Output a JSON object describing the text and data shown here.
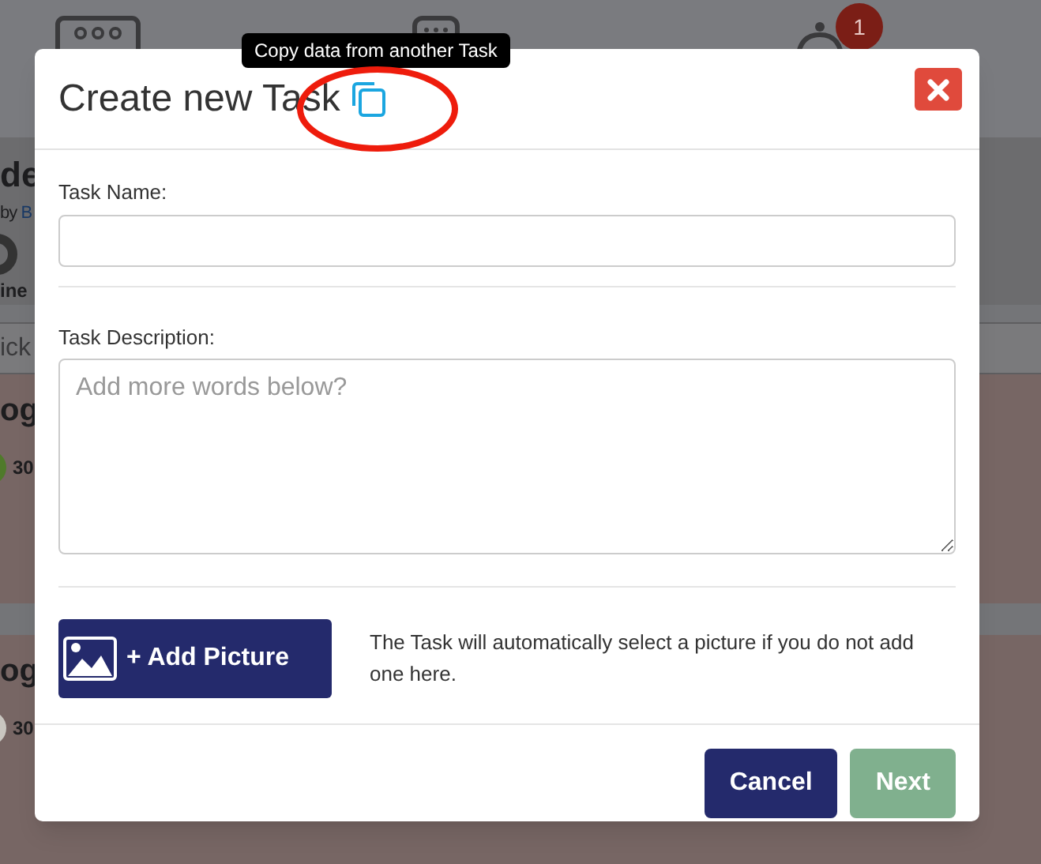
{
  "background": {
    "notification_badge": "1",
    "page_title": "de",
    "byline": {
      "prefix": "by",
      "author": "B"
    },
    "stat_label": "ine",
    "search_placeholder": "ick",
    "cards": [
      {
        "title": "og",
        "count": "30"
      },
      {
        "title": "og",
        "count": "30"
      }
    ]
  },
  "tooltip": "Copy data from another Task",
  "dialog": {
    "title": "Create new Task",
    "fields": [
      {
        "kind": "input",
        "label": "Task Name:"
      },
      {
        "kind": "textarea",
        "label": "Task Description:",
        "placeholder": "Add more words below?"
      }
    ],
    "add_picture_button": "+ Add Picture",
    "picture_note": "The Task will automatically select a picture if you do not add one here.",
    "buttons": [
      {
        "label": "Cancel",
        "kind": "secondary"
      },
      {
        "label": "Next",
        "kind": "primary"
      }
    ]
  }
}
